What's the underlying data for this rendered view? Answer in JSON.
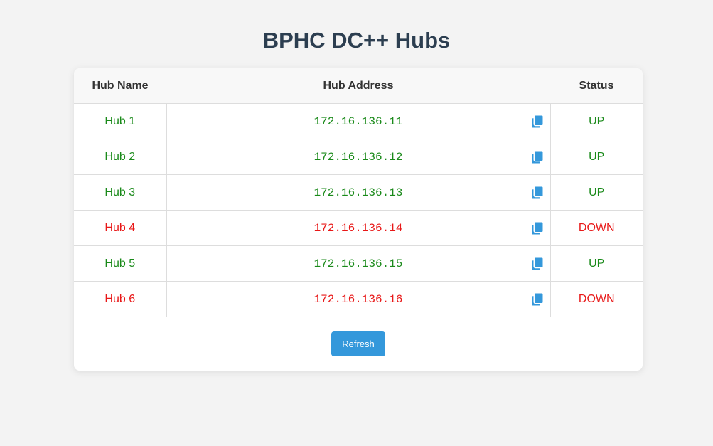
{
  "page": {
    "title": "BPHC DC++ Hubs"
  },
  "table": {
    "headers": {
      "name": "Hub Name",
      "address": "Hub Address",
      "status": "Status"
    },
    "rows": [
      {
        "name": "Hub 1",
        "address": "172.16.136.11",
        "status": "UP"
      },
      {
        "name": "Hub 2",
        "address": "172.16.136.12",
        "status": "UP"
      },
      {
        "name": "Hub 3",
        "address": "172.16.136.13",
        "status": "UP"
      },
      {
        "name": "Hub 4",
        "address": "172.16.136.14",
        "status": "DOWN"
      },
      {
        "name": "Hub 5",
        "address": "172.16.136.15",
        "status": "UP"
      },
      {
        "name": "Hub 6",
        "address": "172.16.136.16",
        "status": "DOWN"
      }
    ]
  },
  "actions": {
    "refresh_label": "Refresh"
  },
  "colors": {
    "title": "#2c3e50",
    "up": "#1a8a1a",
    "down": "#e81818",
    "accent": "#3498db",
    "copy_icon": "#3498db"
  },
  "icons": {
    "copy": "copy-icon"
  }
}
